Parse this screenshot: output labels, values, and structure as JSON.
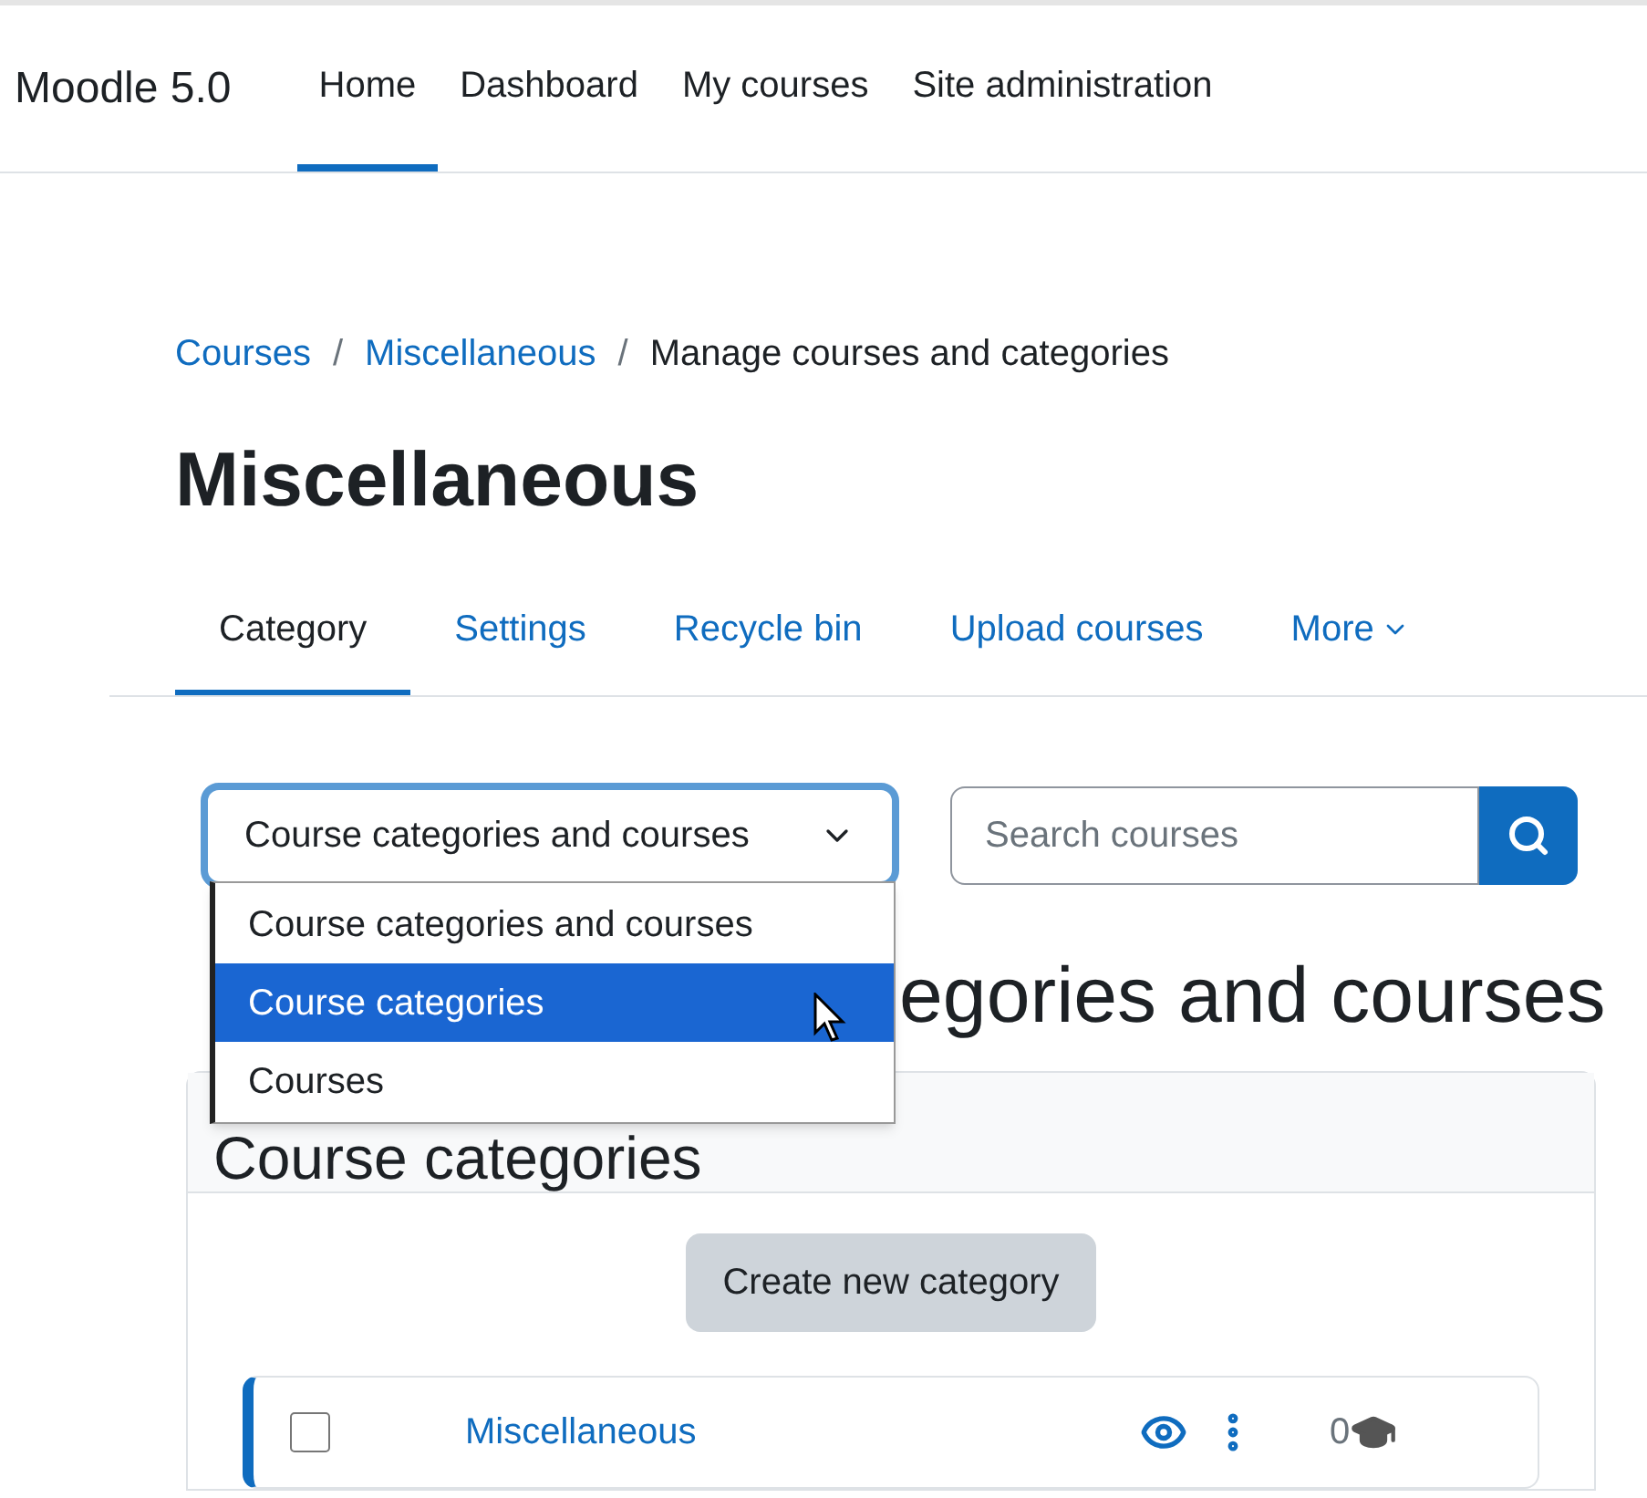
{
  "brand": "Moodle 5.0",
  "nav": [
    {
      "label": "Home",
      "selected": true
    },
    {
      "label": "Dashboard",
      "selected": false
    },
    {
      "label": "My courses",
      "selected": false
    },
    {
      "label": "Site administration",
      "selected": false
    }
  ],
  "breadcrumb": [
    {
      "label": "Courses",
      "kind": "link"
    },
    {
      "label": "/",
      "kind": "separator"
    },
    {
      "label": "Miscellaneous",
      "kind": "link"
    },
    {
      "label": "/",
      "kind": "separator"
    },
    {
      "label": "Manage courses and categories",
      "kind": "current"
    }
  ],
  "title": "Miscellaneous",
  "tabs": [
    {
      "label": "Category",
      "selected": true
    },
    {
      "label": "Settings",
      "selected": false
    },
    {
      "label": "Recycle bin",
      "selected": false
    },
    {
      "label": "Upload courses",
      "selected": false
    },
    {
      "label": "More",
      "selected": false
    }
  ],
  "view_select": {
    "value": "Course categories and courses",
    "expanded": true,
    "options": [
      {
        "label": "Course categories and courses",
        "highlighted": false
      },
      {
        "label": "Course categories",
        "highlighted": true
      },
      {
        "label": "Courses",
        "highlighted": false
      }
    ]
  },
  "search": {
    "placeholder": "Search courses"
  },
  "heading_visible": "egories and courses",
  "card": {
    "title": "Course categories",
    "button": "Create new category",
    "categories": [
      {
        "name": "Miscellaneous",
        "checked": false,
        "visible": true,
        "course_count": "0"
      }
    ]
  }
}
